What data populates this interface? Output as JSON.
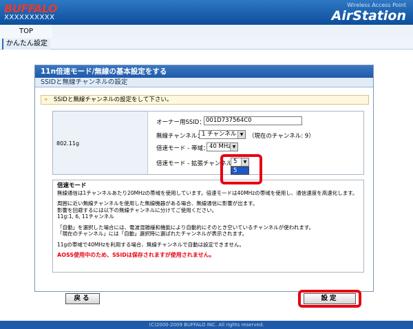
{
  "header": {
    "brand": "BUFFALO",
    "model": "XXXXXXXXXX",
    "product_caption": "Wireless Access Point",
    "product_name": "AirStation"
  },
  "nav": {
    "top_tab": "TOP",
    "sub_tab": "かんたん設定"
  },
  "panel": {
    "title": "11n倍速モード/無線の基本設定をする",
    "subtitle": "SSIDと無線チャンネルの設定",
    "info": "SSIDと無線チャンネルの設定をして下さい。",
    "band_label": "802.11g",
    "fields": {
      "ssid_label": "オーナー用SSID：",
      "ssid_value": "001D737564C0",
      "channel_label": "無線チャンネル：",
      "channel_value": "1 チャンネル",
      "channel_note": "（現在のチャンネル: 9）",
      "bandwidth_label": "倍速モード - 帯域：",
      "bandwidth_value": "40 MHz",
      "ext_channel_label": "倍速モード - 拡張チャンネル：",
      "ext_channel_value": "5",
      "ext_channel_options": [
        "5"
      ]
    }
  },
  "description": {
    "heading": "倍速モード",
    "line1": "無線通信は1チャンネルあたり20MHzの帯域を使用しています。倍速モードは40MHzの帯域を使用し、通信速度を高速化します。",
    "line2": "周囲に近い無線チャンネルを使用した無線機器がある場合、無線通信に影響が出ます。",
    "line3": "影響を回避するには以下の無線チャンネルに分けてご使用ください。",
    "line4": "11g:1, 6, 11チャンネル",
    "line5": "「自動」を選択した場合には、電波混雑緩和機能により自動的にそのとき空いているチャンネルが使われます。",
    "line6": "「現在のチャンネル」には「自動」選択時に選ばれたチャンネルが表示されます。",
    "line7": "11gの帯域で40MHzを利用する場合、無線チャンネルで自動は設定できません。",
    "warning": "AOSS使用中のため、SSIDは保存されますが使用されません。"
  },
  "buttons": {
    "back": "戻る",
    "submit": "設定"
  },
  "footer": "(C)2000-2009 BUFFALO INC. All rights reserved.",
  "colors": {
    "header_blue": "#1f5aa8",
    "brand_red": "#e83a2e",
    "highlight_red": "#e50012",
    "info_bg": "#fff8dc"
  }
}
